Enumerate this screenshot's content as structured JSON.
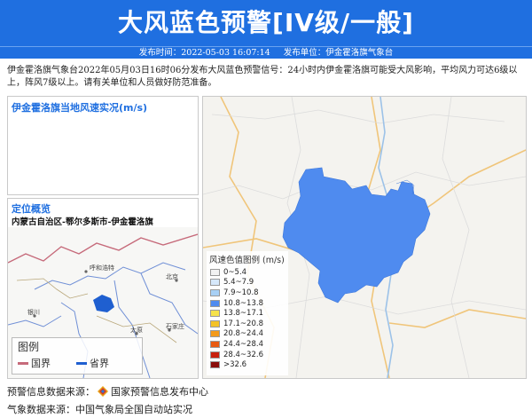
{
  "header": {
    "title": "大风蓝色预警[IV级/一般]",
    "publish_time": "发布时间：2022-05-03 16:07:14",
    "publisher": "发布单位：伊金霍洛旗气象台",
    "banner_color": "#1f6fe0"
  },
  "description": "伊金霍洛旗气象台2022年05月03日16时06分发布大风蓝色预警信号：24小时内伊金霍洛旗可能受大风影响，平均风力可达6级以上，阵风7级以上。请有关单位和人员做好防范准备。",
  "wind_panel": {
    "title": "伊金霍洛旗当地风速实况(m/s)"
  },
  "location_panel": {
    "title": "定位概览",
    "path": "内蒙古自治区-鄂尔多斯市-伊金霍洛旗",
    "places": [
      "呼和浩特",
      "北京",
      "太原",
      "石家庄",
      "银川"
    ],
    "legend": {
      "title": "图例",
      "items": [
        {
          "label": "国界",
          "color": "#c66a7a"
        },
        {
          "label": "省界",
          "color": "#1f5fd0"
        }
      ]
    }
  },
  "wind_legend": {
    "title": "风速色值图例 (m/s)",
    "items": [
      {
        "label": "0~5.4",
        "color": "#f2f2f2"
      },
      {
        "label": "5.4~7.9",
        "color": "#d6e8fb"
      },
      {
        "label": "7.9~10.8",
        "color": "#a8d0f5"
      },
      {
        "label": "10.8~13.8",
        "color": "#4f8bef"
      },
      {
        "label": "13.8~17.1",
        "color": "#f6e24a"
      },
      {
        "label": "17.1~20.8",
        "color": "#f4c227"
      },
      {
        "label": "20.8~24.4",
        "color": "#f39a1a"
      },
      {
        "label": "24.4~28.4",
        "color": "#e85a12"
      },
      {
        "label": "28.4~32.6",
        "color": "#c8200e"
      },
      {
        "label": ">32.6",
        "color": "#8a0d0a"
      }
    ]
  },
  "warning_area_color": "#4f8bef",
  "sources": {
    "warning_label": "预警信息数据来源：",
    "warning_value": "国家预警信息发布中心",
    "weather_label": "气象数据来源：",
    "weather_value": "中国气象局全国自动站实况"
  }
}
